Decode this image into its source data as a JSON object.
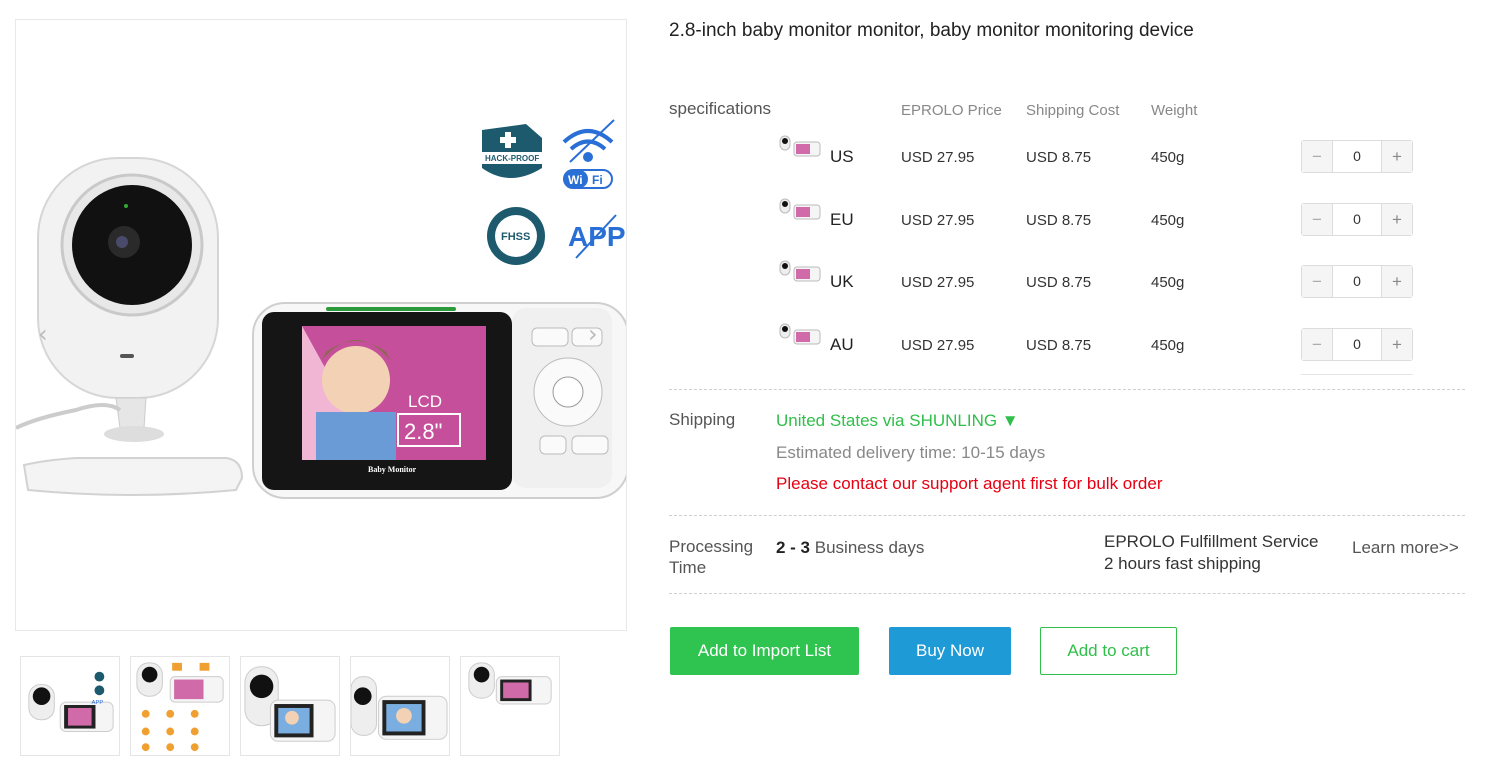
{
  "product": {
    "title": "2.8-inch baby monitor monitor, baby monitor monitoring device",
    "image_badges": {
      "hack_proof": "HACK-PROOF",
      "wifi_left": "Wi",
      "wifi_right": "Fi",
      "fhss": "FHSS",
      "app": "APP",
      "lcd": "LCD",
      "lcd_size": "2.8\"",
      "brand": "Baby Monitor"
    }
  },
  "gallery": {
    "prev_icon": "chevron-left-icon",
    "next_icon": "chevron-right-icon",
    "thumbnail_count": 5
  },
  "specs": {
    "label": "specifications",
    "headers": {
      "price": "EPROLO Price",
      "shipping": "Shipping Cost",
      "weight": "Weight"
    },
    "rows": [
      {
        "country": "US",
        "price": "USD 27.95",
        "shipping": "USD 8.75",
        "weight": "450g",
        "qty": "0"
      },
      {
        "country": "EU",
        "price": "USD 27.95",
        "shipping": "USD 8.75",
        "weight": "450g",
        "qty": "0"
      },
      {
        "country": "UK",
        "price": "USD 27.95",
        "shipping": "USD 8.75",
        "weight": "450g",
        "qty": "0"
      },
      {
        "country": "AU",
        "price": "USD 27.95",
        "shipping": "USD 8.75",
        "weight": "450g",
        "qty": "0"
      }
    ],
    "minus": "−",
    "plus": "+"
  },
  "shipping": {
    "label": "Shipping",
    "method": "United States via SHUNLING ▼",
    "estimate": "Estimated delivery time: 10-15 days",
    "warning": "Please contact our support agent first for bulk order"
  },
  "processing": {
    "label": "Processing Time",
    "days_bold": "2 - 3",
    "days_rest": " Business days",
    "service_line1": "EPROLO Fulfillment Service",
    "service_line2": "2 hours fast shipping",
    "learn_more": "Learn more>>"
  },
  "actions": {
    "import": "Add to Import List",
    "buy": "Buy Now",
    "cart": "Add to cart"
  },
  "colors": {
    "green": "#2fc44f",
    "blue": "#1e9ad6",
    "red": "#e60012",
    "badge_teal": "#1d5a6e",
    "wifi_blue": "#2a6fd6"
  }
}
